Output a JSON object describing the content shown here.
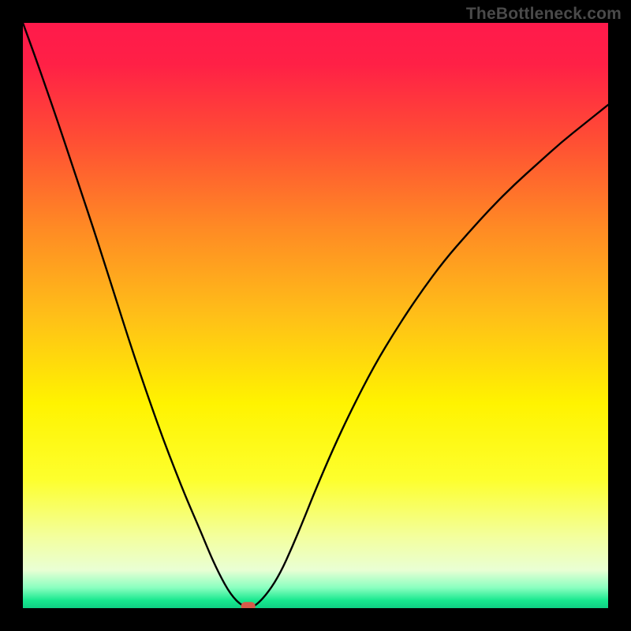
{
  "watermark": "TheBottleneck.com",
  "chart_data": {
    "type": "line",
    "title": "",
    "xlabel": "",
    "ylabel": "",
    "xlim": [
      0,
      100
    ],
    "ylim": [
      0,
      100
    ],
    "grid": false,
    "background_gradient": {
      "stops": [
        {
          "pos": 0.0,
          "color": "#ff1a4b"
        },
        {
          "pos": 0.07,
          "color": "#ff2046"
        },
        {
          "pos": 0.2,
          "color": "#ff4e34"
        },
        {
          "pos": 0.35,
          "color": "#ff8a24"
        },
        {
          "pos": 0.5,
          "color": "#ffbf18"
        },
        {
          "pos": 0.65,
          "color": "#fff300"
        },
        {
          "pos": 0.78,
          "color": "#fdff2d"
        },
        {
          "pos": 0.88,
          "color": "#f3ffa0"
        },
        {
          "pos": 0.935,
          "color": "#e9ffd4"
        },
        {
          "pos": 0.965,
          "color": "#8affc0"
        },
        {
          "pos": 0.987,
          "color": "#17e88e"
        },
        {
          "pos": 1.0,
          "color": "#0fd084"
        }
      ]
    },
    "curve": {
      "description": "V-shaped bottleneck curve, apex near x≈38",
      "x": [
        0,
        2,
        4,
        6,
        8,
        10,
        12,
        14,
        16,
        18,
        20,
        22,
        24,
        26,
        28,
        30,
        32,
        33,
        34,
        35,
        36,
        37,
        38,
        39,
        40,
        42,
        44,
        46,
        48,
        50,
        53,
        56,
        60,
        64,
        68,
        72,
        76,
        80,
        84,
        88,
        92,
        96,
        100
      ],
      "y": [
        100,
        94.5,
        88.8,
        83.0,
        77.0,
        71.0,
        65.0,
        58.8,
        52.5,
        46.2,
        40.2,
        34.4,
        28.8,
        23.6,
        18.6,
        14.0,
        9.2,
        7.0,
        5.0,
        3.2,
        1.8,
        0.8,
        0.2,
        0.2,
        0.6,
        2.8,
        6.0,
        10.4,
        15.2,
        20.2,
        27.2,
        33.6,
        41.4,
        48.0,
        54.0,
        59.4,
        64.0,
        68.4,
        72.4,
        76.0,
        79.6,
        82.8,
        86.0
      ]
    },
    "marker": {
      "x": 38.5,
      "y": 0.3,
      "color": "#d75a4a",
      "shape": "rounded-rect"
    }
  }
}
